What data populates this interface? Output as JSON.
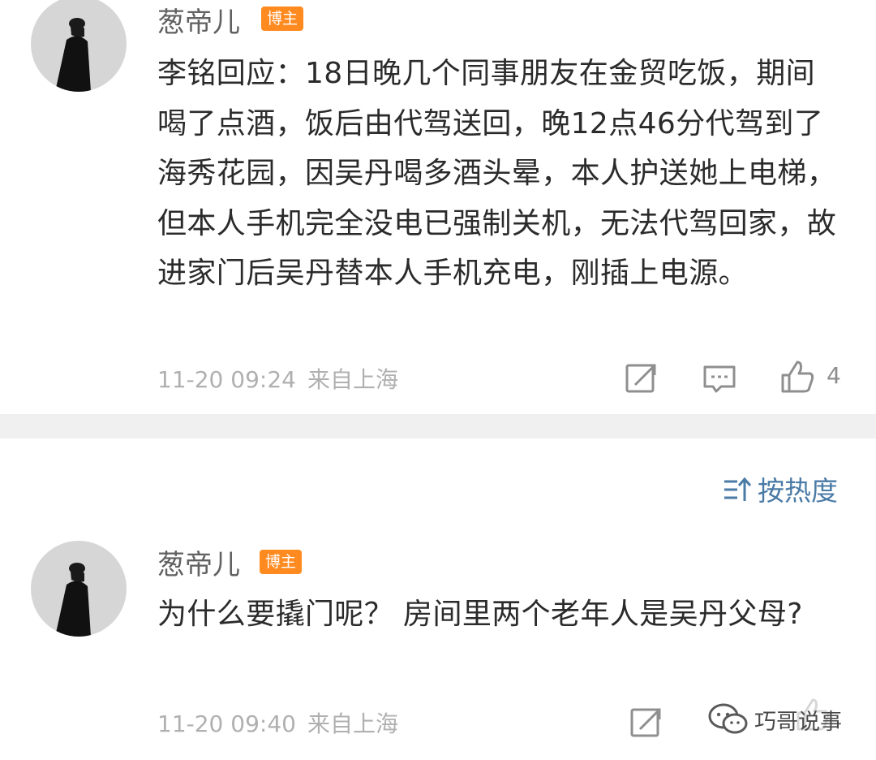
{
  "comments": [
    {
      "username": "葱帝儿",
      "badge": "博主",
      "text": "李铭回应：18日晚几个同事朋友在金贸吃饭，期间喝了点酒，饭后由代驾送回，晚12点46分代驾到了海秀花园，因吴丹喝多酒头晕，本人护送她上电梯，但本人手机完全没电已强制关机，无法代驾回家，故进家门后吴丹替本人手机充电，刚插上电源。",
      "date": "11-20 09:24",
      "location": "来自上海",
      "likes": "4",
      "icons": [
        "share-icon",
        "comment-icon",
        "like-icon"
      ]
    },
    {
      "username": "葱帝儿",
      "badge": "博主",
      "text": "为什么要撬门呢？ 房间里两个老年人是吴丹父母?",
      "date": "11-20 09:40",
      "location": "来自上海",
      "icons": [
        "share-icon",
        "comment-icon",
        "like-icon"
      ]
    }
  ],
  "sort": {
    "label": "按热度",
    "icon": "sort-icon"
  },
  "watermark": {
    "text": "巧哥说事",
    "icon": "wechat-icon"
  },
  "colors": {
    "badge": "#ff8a1f",
    "sort_link": "#4a7aa6",
    "divider": "#f0f0f0",
    "avatar_bg": "#d6d6d6"
  }
}
